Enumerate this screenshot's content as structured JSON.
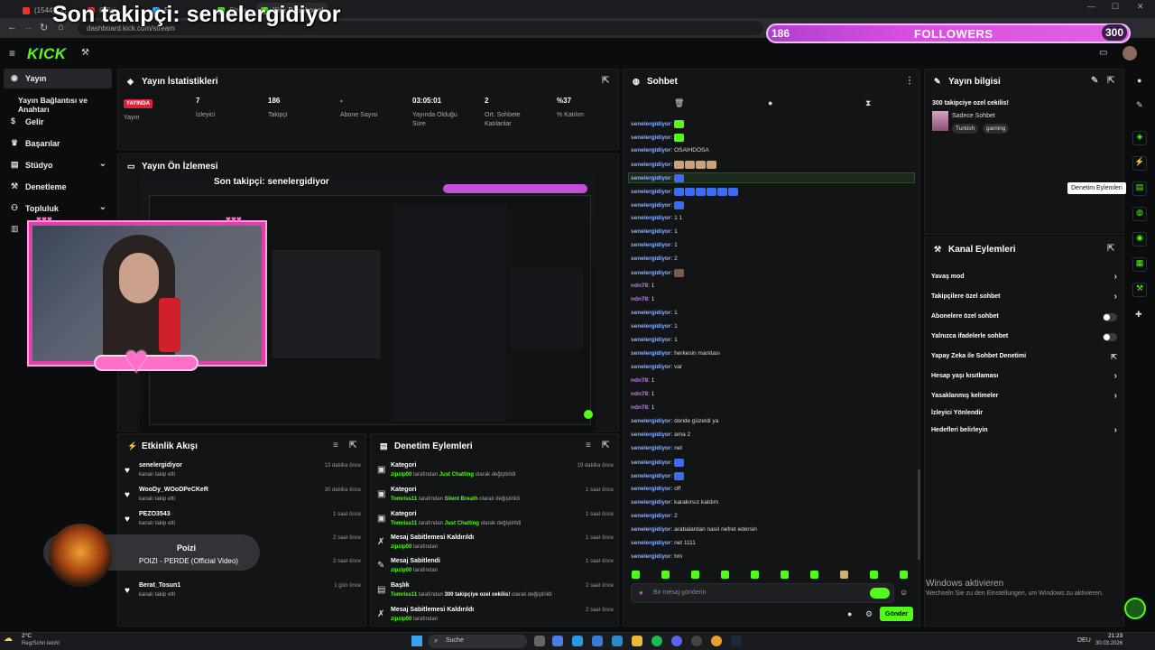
{
  "browser": {
    "tabs": [
      "(1544) Un...",
      "Offici...",
      "Ef...",
      "Strea...",
      "Kick Dashboard"
    ],
    "url": "dashboard.kick.com/stream"
  },
  "overlay": {
    "last_follower": "Son takipçi: senelergidiyor",
    "follower_count": "186",
    "followers_label": "FOLLOWERS",
    "follower_goal": "300"
  },
  "sidebar": {
    "items": [
      {
        "label": "Yayın",
        "icon": "broadcast-icon"
      },
      {
        "label": "Yayın Bağlantısı ve Anahtarı",
        "icon": ""
      },
      {
        "label": "Gelir",
        "icon": "dollar-icon"
      },
      {
        "label": "Başarılar",
        "icon": "trophy-icon"
      },
      {
        "label": "Stüdyo",
        "icon": "studio-icon"
      },
      {
        "label": "Denetleme",
        "icon": "hammer-icon"
      },
      {
        "label": "Topluluk",
        "icon": "community-icon"
      }
    ]
  },
  "stats": {
    "title": "Yayın İstatistikleri",
    "status_badge": "YAYINDA",
    "status_label": "Yayın",
    "items": [
      {
        "value": "7",
        "label": "İzleyici"
      },
      {
        "value": "186",
        "label": "Takipçi"
      },
      {
        "value": "-",
        "label": "Abone Sayısı"
      },
      {
        "value": "03:05:01",
        "label": "Yayında Olduğu Süre"
      },
      {
        "value": "2",
        "label": "Ort. Sohbete Katılanlar"
      },
      {
        "value": "%37",
        "label": "% Katılım"
      }
    ]
  },
  "preview": {
    "title": "Yayın Ön İzlemesi",
    "inner_overlay": "Son takipçi: senelergidiyor"
  },
  "activity": {
    "title": "Etkinlik Akışı",
    "items": [
      {
        "name": "senelergidiyor",
        "sub": "kanalı takip etti",
        "time": "13 dakika önce"
      },
      {
        "name": "WooDy_WOoDPeCKeR",
        "sub": "kanalı takip etti",
        "time": "30 dakika önce"
      },
      {
        "name": "PEZO3543",
        "sub": "kanalı takip etti",
        "time": "1 saat önce"
      },
      {
        "name": "",
        "sub": "",
        "time": "2 saat önce"
      },
      {
        "name": "",
        "sub": "",
        "time": "2 saat önce"
      },
      {
        "name": "Berat_Tosun1",
        "sub": "kanalı takip etti",
        "time": "1 gün önce"
      }
    ],
    "now_playing": {
      "artist": "Poizi",
      "track": "POIZI - PERDE (Official Video)"
    }
  },
  "moderation": {
    "title": "Denetim Eylemleri",
    "items": [
      {
        "action": "Kategori",
        "actor": "zipzip00",
        "mid": " tarafından ",
        "hl": "Just Chatting",
        "end": " olarak değiştirildi",
        "time": "19 dakika önce",
        "icon": "category-icon"
      },
      {
        "action": "Kategori",
        "actor": "Tomriss11",
        "mid": " tarafından ",
        "hl": "Silent Breath",
        "end": " olarak değiştirildi",
        "time": "1 saat önce",
        "icon": "category-icon"
      },
      {
        "action": "Kategori",
        "actor": "Tomriss11",
        "mid": " tarafından ",
        "hl": "Just Chatting",
        "end": " olarak değiştirildi",
        "time": "1 saat önce",
        "icon": "category-icon"
      },
      {
        "action": "Mesaj Sabitlemesi Kaldırıldı",
        "actor": "zipzip00",
        "mid": " tarafından",
        "hl": "",
        "end": "",
        "time": "1 saat önce",
        "icon": "unpin-icon"
      },
      {
        "action": "Mesaj Sabitlendi",
        "actor": "zipzip00",
        "mid": " tarafından",
        "hl": "",
        "end": "",
        "time": "1 saat önce",
        "icon": "pin-icon"
      },
      {
        "action": "Başlık",
        "actor": "Tomriss11",
        "mid": " tarafından ",
        "hl": "300 takipçiye ozel cekilis!",
        "end": " olarak değiştirildi",
        "time": "2 saat önce",
        "icon": "title-icon"
      },
      {
        "action": "Mesaj Sabitlemesi Kaldırıldı",
        "actor": "zipzip00",
        "mid": " tarafından",
        "hl": "",
        "end": "",
        "time": "2 saat önce",
        "icon": "unpin-icon"
      }
    ]
  },
  "chat": {
    "title": "Sohbet",
    "placeholder": "Bir mesaj gönderin",
    "send_label": "Gönder",
    "messages": [
      {
        "user": "senelergidiyor",
        "text": "",
        "emotes": 1,
        "color": "#53fc18"
      },
      {
        "user": "senelergidiyor",
        "text": "",
        "emotes": 1,
        "color": "#53fc18"
      },
      {
        "user": "senelergidiyor",
        "text": "OSAIHDOSA",
        "emotes": 0,
        "color": ""
      },
      {
        "user": "senelergidiyor",
        "text": "",
        "emotes": 4,
        "color": "#c9a27a"
      },
      {
        "user": "senelergidiyor",
        "text": "",
        "emotes": 1,
        "color": "#3a6cf5",
        "highlight": true
      },
      {
        "user": "senelergidiyor",
        "text": "",
        "emotes": 6,
        "color": "#3a6cf5"
      },
      {
        "user": "senelergidiyor",
        "text": "",
        "emotes": 1,
        "color": "#3a6cf5"
      },
      {
        "user": "senelergidiyor",
        "text": "1 1",
        "emotes": 0,
        "color": ""
      },
      {
        "user": "senelergidiyor",
        "text": "1",
        "emotes": 0,
        "color": ""
      },
      {
        "user": "senelergidiyor",
        "text": "1",
        "emotes": 0,
        "color": ""
      },
      {
        "user": "senelergidiyor",
        "text": "2",
        "emotes": 0,
        "color": ""
      },
      {
        "user": "senelergidiyor",
        "text": "",
        "emotes": 1,
        "color": "#7a5a4a"
      },
      {
        "user": "ndn78",
        "text": "1",
        "emotes": 0,
        "color": "",
        "purple": true
      },
      {
        "user": "ndn78",
        "text": "1",
        "emotes": 0,
        "color": "",
        "purple": true
      },
      {
        "user": "senelergidiyor",
        "text": "1",
        "emotes": 0,
        "color": ""
      },
      {
        "user": "senelergidiyor",
        "text": "1",
        "emotes": 0,
        "color": ""
      },
      {
        "user": "senelergidiyor",
        "text": "1",
        "emotes": 0,
        "color": ""
      },
      {
        "user": "senelergidiyor",
        "text": "herkesin manitası",
        "emotes": 0,
        "color": ""
      },
      {
        "user": "senelergidiyor",
        "text": "var",
        "emotes": 0,
        "color": ""
      },
      {
        "user": "ndn78",
        "text": "1",
        "emotes": 0,
        "color": "",
        "purple": true
      },
      {
        "user": "ndn78",
        "text": "1",
        "emotes": 0,
        "color": "",
        "purple": true
      },
      {
        "user": "ndn78",
        "text": "1",
        "emotes": 0,
        "color": "",
        "purple": true
      },
      {
        "user": "senelergidiyor",
        "text": "doride güzeldi ya",
        "emotes": 0,
        "color": ""
      },
      {
        "user": "senelergidiyor",
        "text": "ama 2",
        "emotes": 0,
        "color": ""
      },
      {
        "user": "senelergidiyor",
        "text": "net",
        "emotes": 0,
        "color": ""
      },
      {
        "user": "senelergidiyor",
        "text": "",
        "emotes": 1,
        "color": "#3a6cf5"
      },
      {
        "user": "senelergidiyor",
        "text": "",
        "emotes": 1,
        "color": "#3a6cf5"
      },
      {
        "user": "senelergidiyor",
        "text": "off",
        "emotes": 0,
        "color": ""
      },
      {
        "user": "senelergidiyor",
        "text": "karakırsız kaldım",
        "emotes": 0,
        "color": ""
      },
      {
        "user": "senelergidiyor",
        "text": "2",
        "emotes": 0,
        "color": ""
      },
      {
        "user": "senelergidiyor",
        "text": "arabalardan nasıl nefret edersin",
        "emotes": 0,
        "color": ""
      },
      {
        "user": "senelergidiyor",
        "text": "net 1111",
        "emotes": 0,
        "color": ""
      },
      {
        "user": "senelergidiyor",
        "text": "hm",
        "emotes": 0,
        "color": ""
      }
    ]
  },
  "stream_info": {
    "title": "Yayın bilgisi",
    "stream_title": "300 takipciye ozel cekilis!",
    "category": "Sadece Sohbet",
    "tags": [
      "Turkish",
      "gaming"
    ]
  },
  "tooltip": "Denetim Eylemleri",
  "channel_actions": {
    "title": "Kanal Eylemleri",
    "items": [
      {
        "label": "Yavaş mod",
        "kind": "chevron"
      },
      {
        "label": "Takipçilere özel sohbet",
        "kind": "chevron"
      },
      {
        "label": "Abonelere özel sohbet",
        "kind": "toggle"
      },
      {
        "label": "Yalnızca ifadelerle sohbet",
        "kind": "toggle"
      },
      {
        "label": "Yapay Zeka ile Sohbet Denetimi",
        "kind": "external"
      },
      {
        "label": "Hesap yaşı kısıtlaması",
        "kind": "chevron"
      },
      {
        "label": "Yasaklanmış kelimeler",
        "kind": "chevron"
      },
      {
        "label": "İzleyici Yönlendir",
        "kind": "none"
      },
      {
        "label": "Hedefleri belirleyin",
        "kind": "chevron"
      }
    ]
  },
  "windows": {
    "activate_title": "Windows aktivieren",
    "activate_sub": "Wechseln Sie zu den Einstellungen, um Windows zu aktivieren.",
    "weather_temp": "2°C",
    "weather_desc": "Reg/Schn leicht",
    "search": "Suche",
    "lang": "DEU",
    "time": "21:23",
    "date": "30.03.2026"
  }
}
